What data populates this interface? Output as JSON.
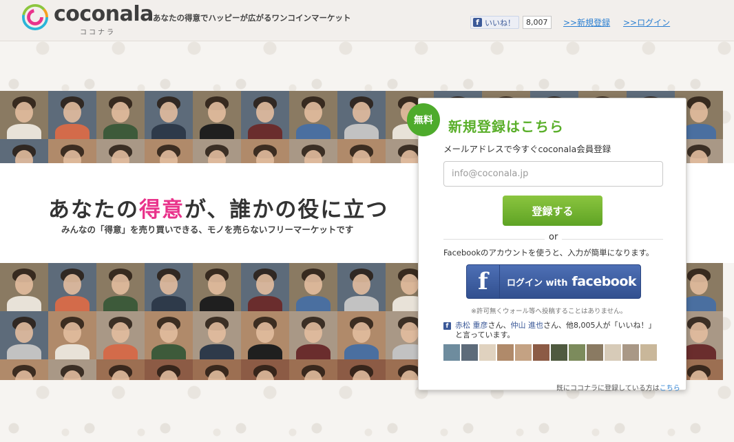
{
  "header": {
    "brand": "coconala",
    "brand_sub": "ココナラ",
    "tagline": "あなたの得意でハッピーが広がるワンコインマーケット",
    "like_label": "いいね！",
    "like_count": "8,007",
    "signup_link": ">>新規登録",
    "login_link": ">>ログイン"
  },
  "hero": {
    "headline_part1": "あなたの",
    "headline_highlight": "得意",
    "headline_part2": "が、誰かの役に立つ",
    "subline": "みんなの「得意」を売り買いできる、モノを売らないフリーマーケットです"
  },
  "signup_panel": {
    "badge": "無料",
    "title": "新規登録はこちら",
    "subtitle": "メールアドレスで今すぐcoconala会員登録",
    "email_placeholder": "info@coconala.jp",
    "register_button": "登録する",
    "or_text": "or",
    "facebook_desc": "Facebookのアカウントを使うと、入力が簡単になります。",
    "facebook_button_login": "ログイン with",
    "facebook_button_brand": "facebook",
    "facebook_note": "※許可無くウォール等へ投稿することはありません。",
    "likers_name1": "赤松 重彦",
    "likers_san1": "さん、",
    "likers_name2": "仲山 進也",
    "likers_rest": "さん、他8,005人が「いいね！」",
    "likers_line2": "と言っています。"
  },
  "footer": {
    "already_text": "既にココナラに登録している方は",
    "here_link": "こちら"
  },
  "colors": {
    "accent_green": "#5aaf2a",
    "highlight_pink": "#e9338b",
    "facebook_blue": "#3b5998",
    "link_blue": "#2a7fd1"
  }
}
